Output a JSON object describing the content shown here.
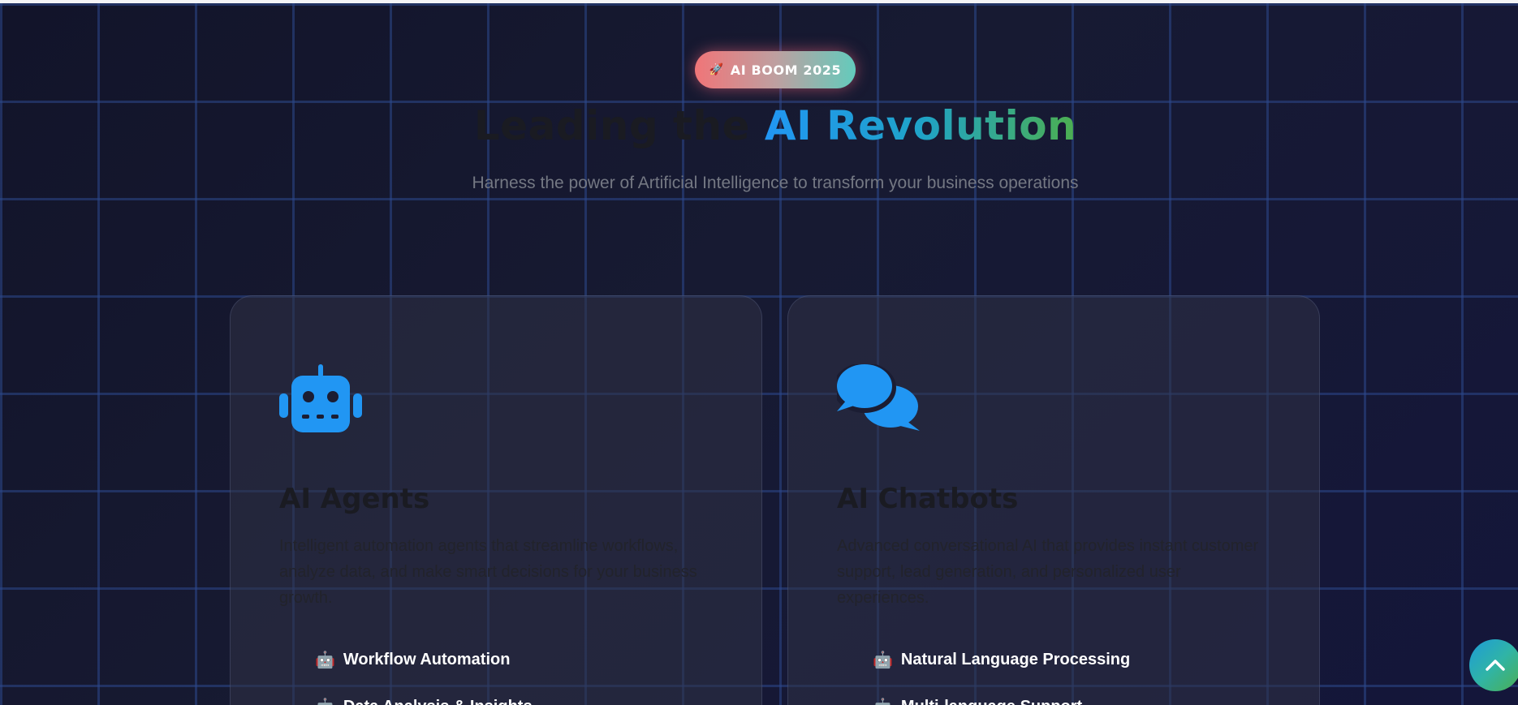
{
  "hero": {
    "badge_icon": "🚀",
    "badge_label": "AI BOOM 2025",
    "headline_dark": "Leading the ",
    "headline_gradient": "AI Revolution",
    "subtitle": "Harness the power of Artificial Intelligence to transform your business operations"
  },
  "cards": [
    {
      "icon": "robot-icon",
      "title": "AI Agents",
      "description": "Intelligent automation agents that streamline workflows, analyze data, and make smart decisions for your business growth.",
      "features": [
        {
          "emoji": "🤖",
          "label": "Workflow Automation"
        },
        {
          "emoji": "🤖",
          "label": "Data Analysis & Insights"
        }
      ]
    },
    {
      "icon": "chat-bubbles-icon",
      "title": "AI Chatbots",
      "description": "Advanced conversational AI that provides instant customer support, lead generation, and personalized user experiences.",
      "features": [
        {
          "emoji": "🤖",
          "label": "Natural Language Processing"
        },
        {
          "emoji": "🤖",
          "label": "Multi-language Support"
        }
      ]
    }
  ],
  "scroll_top": {
    "icon": "chevron-up-icon"
  },
  "colors": {
    "background": "#14152a",
    "grid_line": "#2c488c",
    "icon_blue": "#2196f3",
    "badge_start": "#f07578",
    "badge_end": "#63cbbc",
    "headline_gradient_start": "#2196f3",
    "headline_gradient_end": "#4caf50"
  }
}
